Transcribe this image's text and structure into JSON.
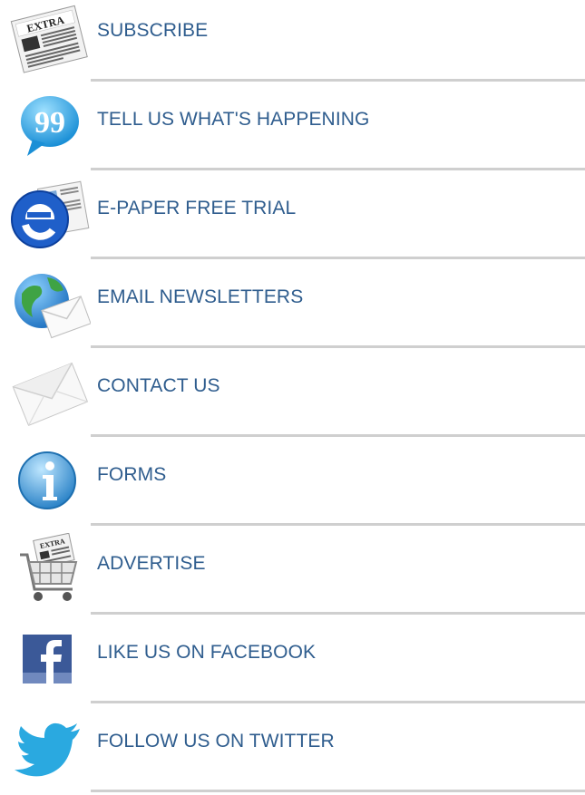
{
  "menu": {
    "items": [
      {
        "label": "SUBSCRIBE",
        "icon": "newspaper-extra-icon"
      },
      {
        "label": "TELL US WHAT'S HAPPENING",
        "icon": "quote-bubble-icon"
      },
      {
        "label": "E-PAPER FREE TRIAL",
        "icon": "e-paper-icon"
      },
      {
        "label": "EMAIL NEWSLETTERS",
        "icon": "globe-envelope-icon"
      },
      {
        "label": "CONTACT US",
        "icon": "envelope-icon"
      },
      {
        "label": "FORMS",
        "icon": "info-icon"
      },
      {
        "label": "ADVERTISE",
        "icon": "shopping-cart-newspaper-icon"
      },
      {
        "label": "LIKE US ON FACEBOOK",
        "icon": "facebook-icon"
      },
      {
        "label": "FOLLOW US ON TWITTER",
        "icon": "twitter-bird-icon"
      }
    ],
    "icon_texts": {
      "newspaper": "EXTRA"
    }
  },
  "colors": {
    "link": "#2f5d8e",
    "divider": "#cfcfcf",
    "twitter": "#2aa9e0",
    "facebook": "#3b5998"
  }
}
